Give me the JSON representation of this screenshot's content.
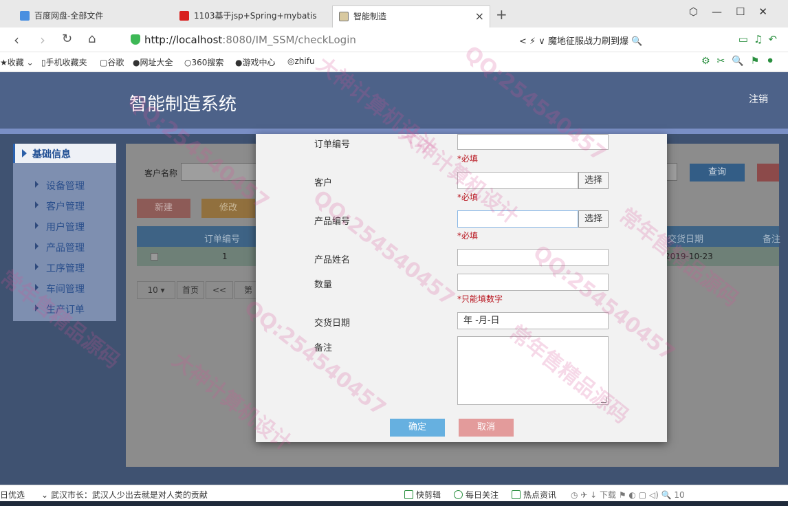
{
  "browser": {
    "tabs": [
      {
        "label": "百度网盘-全部文件",
        "icon": "cloud-icon"
      },
      {
        "label": "1103基于jsp+Spring+mybatis",
        "icon": "red-square-icon"
      },
      {
        "label": "智能制造",
        "icon": "page-icon",
        "active": true
      }
    ],
    "url": {
      "host": "http://localhost",
      "rest": ":8080/IM_SSM/checkLogin"
    },
    "search_suggestion": "魔地征服战力刷到爆",
    "bookmarks": [
      "收藏",
      "手机收藏夹",
      "谷歌",
      "网址大全",
      "360搜索",
      "游戏中心",
      "zhifu"
    ]
  },
  "app": {
    "title": "智能制造系统",
    "logout": "注销"
  },
  "sidebar": {
    "header": "基础信息",
    "items": [
      {
        "label": "设备管理"
      },
      {
        "label": "客户管理"
      },
      {
        "label": "用户管理"
      },
      {
        "label": "产品管理"
      },
      {
        "label": "工序管理"
      },
      {
        "label": "车间管理"
      },
      {
        "label": "生产订单"
      }
    ]
  },
  "list": {
    "search_label": "客户名称",
    "query_button": "查询",
    "new_button": "新建",
    "edit_button": "修改",
    "columns": {
      "order_no": "订单编号",
      "delivery_date": "交货日期",
      "remark": "备注"
    },
    "rows": [
      {
        "order_no": "1",
        "delivery_date": "2019-10-23"
      }
    ],
    "pager": {
      "page_size": "10 ▾",
      "first": "首页",
      "prev": "<<",
      "page": "第"
    }
  },
  "modal": {
    "fields": {
      "order_no": {
        "label": "订单编号",
        "value": "",
        "hint": "*必填"
      },
      "customer": {
        "label": "客户",
        "value": "",
        "hint": "*必填",
        "select_button": "选择"
      },
      "product_no": {
        "label": "产品编号",
        "value": "",
        "hint": "*必填",
        "select_button": "选择"
      },
      "product_name": {
        "label": "产品姓名",
        "value": ""
      },
      "quantity": {
        "label": "数量",
        "value": "",
        "hint": "*只能填数字"
      },
      "delivery_date": {
        "label": "交货日期",
        "value": "年 -月-日"
      },
      "remark": {
        "label": "备注",
        "value": ""
      }
    },
    "ok_button": "确定",
    "cancel_button": "取消"
  },
  "statusbar": {
    "left": "日优选",
    "news": "武汉市长：武汉人少出去就是对人类的贡献",
    "items": [
      "快剪辑",
      "每日关注",
      "热点资讯",
      "下载"
    ],
    "zoom": "10"
  },
  "watermark": [
    "QQ:254540457",
    "大神计算机设计",
    "常年售精品源码"
  ]
}
